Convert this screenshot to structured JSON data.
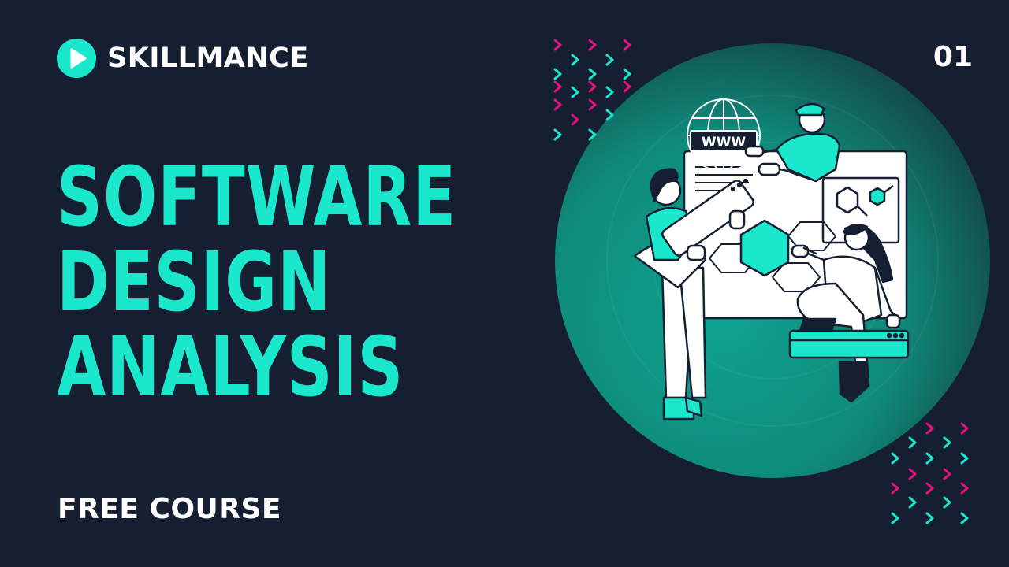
{
  "brand": {
    "name": "SKILLMANCE",
    "logo_icon": "play-circle-icon"
  },
  "episode": {
    "number": "01"
  },
  "headline": {
    "line1": "SOFTWARE",
    "line2": "DESIGN",
    "line3": "ANALYSIS"
  },
  "subtitle": "FREE COURSE",
  "illustration": {
    "globe_label": "WWW"
  },
  "colors": {
    "background": "#151f31",
    "accent": "#1be7cd",
    "pink": "#e3137f",
    "white": "#ffffff"
  }
}
